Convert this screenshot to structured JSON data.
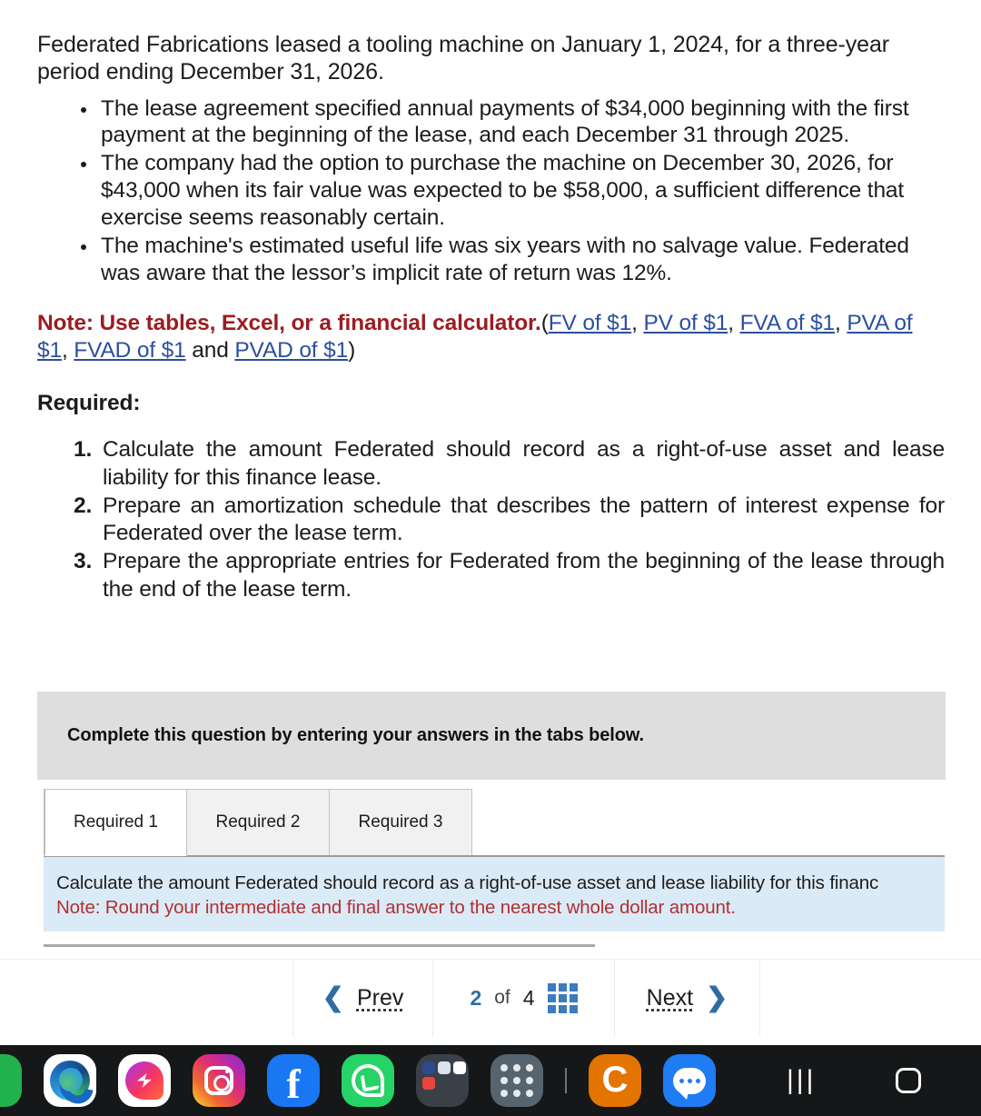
{
  "problem": {
    "intro": "Federated Fabrications leased a tooling machine on January 1, 2024, for a three-year period ending December 31, 2026.",
    "bullets": [
      "The lease agreement specified annual payments of $34,000 beginning with the first payment at the beginning of the lease, and each December 31 through 2025.",
      "The company had the option to purchase the machine on December 30, 2026, for $43,000 when its fair value was expected to be $58,000, a sufficient difference that exercise seems reasonably certain.",
      "The machine's estimated useful life was six years with no salvage value. Federated was aware that the lessor’s implicit rate of return was 12%."
    ]
  },
  "note": {
    "lead": "Note: Use tables, Excel, or a financial calculator.",
    "open_paren": "(",
    "links": [
      "FV of $1",
      "PV of $1",
      "FVA of $1",
      "PVA of $1",
      "FVAD of $1",
      "PVAD of $1"
    ],
    "sep_comma": ", ",
    "sep_and": " and ",
    "close_paren": ")"
  },
  "required": {
    "heading": "Required:",
    "items": [
      "Calculate the amount Federated should record as a right-of-use asset and lease liability for this finance lease.",
      "Prepare an amortization schedule that describes the pattern of interest expense for Federated over the lease term.",
      "Prepare the appropriate entries for Federated from the beginning of the lease through the end of the lease term."
    ]
  },
  "banner": {
    "text": "Complete this question by entering your answers in the tabs below."
  },
  "tabs": {
    "items": [
      {
        "label": "Required 1",
        "active": true
      },
      {
        "label": "Required 2",
        "active": false
      },
      {
        "label": "Required 3",
        "active": false
      }
    ]
  },
  "info_panel": {
    "line1": "Calculate the amount Federated should record as a right-of-use asset and lease liability for this financ",
    "line2": "Note: Round your intermediate and final answer to the nearest whole dollar amount."
  },
  "pager": {
    "prev_label": "Prev",
    "next_label": "Next",
    "prev_icon": "chevron-left-icon",
    "next_icon": "chevron-right-icon",
    "grid_icon": "grid-menu-icon",
    "current_page": "2",
    "of_label": "of",
    "total_pages": "4"
  },
  "taskbar": {
    "apps": [
      {
        "name": "partial-app-icon",
        "label": ""
      },
      {
        "name": "edge-icon",
        "label": ""
      },
      {
        "name": "messenger-icon",
        "label": ""
      },
      {
        "name": "instagram-icon",
        "label": ""
      },
      {
        "name": "facebook-icon",
        "label": "f"
      },
      {
        "name": "whatsapp-icon",
        "label": ""
      },
      {
        "name": "app-folder-icon",
        "label": ""
      },
      {
        "name": "app-drawer-icon",
        "label": ""
      }
    ],
    "divider": "|",
    "apps_right": [
      {
        "name": "chrome-beta-icon",
        "label": "C"
      },
      {
        "name": "messages-icon",
        "label": ""
      }
    ],
    "nav": {
      "recents_icon": "recents-icon",
      "recents_glyph": "|||",
      "home_icon": "home-icon",
      "back_icon": "back-icon",
      "back_glyph": "‹"
    }
  },
  "colors": {
    "note_red": "#9c1c22",
    "link_blue": "#2b4f9e",
    "panel_blue": "#dbeaf7",
    "banner_gray": "#dedede",
    "accent_blue": "#2e6da4",
    "warn_red": "#b23030"
  }
}
